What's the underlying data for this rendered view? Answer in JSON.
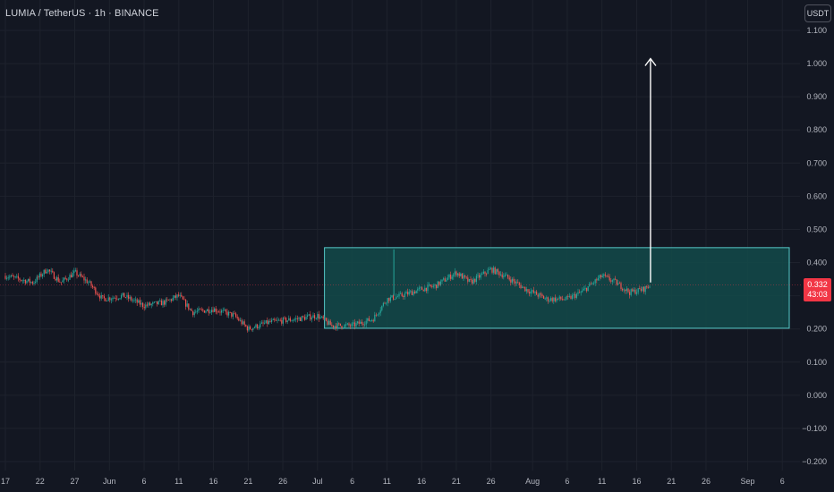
{
  "header": {
    "ticker_title": "LUMIA / TetherUS · 1h · BINANCE",
    "currency_label": "USDT"
  },
  "price_badge": {
    "value": "0.332",
    "countdown": "43:03"
  },
  "colors": {
    "background": "#131722",
    "grid": "#1e222d",
    "candle_up": "#26a69a",
    "candle_down": "#ef5350",
    "range_box_fill": "#134a4a",
    "range_box_border": "#56c8c8",
    "arrow": "#ffffff",
    "price_line": "#f23645"
  },
  "chart_data": {
    "type": "candlestick",
    "y_axis": {
      "min": -0.2,
      "max": 1.1,
      "ticks": [
        1.1,
        1.0,
        0.9,
        0.8,
        0.7,
        0.6,
        0.5,
        0.4,
        0.3,
        0.2,
        0.1,
        0.0,
        -0.1,
        -0.2
      ],
      "tick_labels": [
        "1.100",
        "1.000",
        "0.900",
        "0.800",
        "0.700",
        "0.600",
        "0.500",
        "0.400",
        "",
        "0.200",
        "0.100",
        "0.000",
        "−0.100",
        "−0.200"
      ]
    },
    "x_axis": {
      "start": "2025-05-17",
      "end": "2025-09-07",
      "ticks": [
        {
          "date": "2025-05-17",
          "label": "17"
        },
        {
          "date": "2025-05-22",
          "label": "22"
        },
        {
          "date": "2025-05-27",
          "label": "27"
        },
        {
          "date": "2025-06-01",
          "label": "Jun"
        },
        {
          "date": "2025-06-06",
          "label": "6"
        },
        {
          "date": "2025-06-11",
          "label": "11"
        },
        {
          "date": "2025-06-16",
          "label": "16"
        },
        {
          "date": "2025-06-21",
          "label": "21"
        },
        {
          "date": "2025-06-26",
          "label": "26"
        },
        {
          "date": "2025-07-01",
          "label": "Jul"
        },
        {
          "date": "2025-07-06",
          "label": "6"
        },
        {
          "date": "2025-07-11",
          "label": "11"
        },
        {
          "date": "2025-07-16",
          "label": "16"
        },
        {
          "date": "2025-07-21",
          "label": "21"
        },
        {
          "date": "2025-07-26",
          "label": "26"
        },
        {
          "date": "2025-08-01",
          "label": "Aug"
        },
        {
          "date": "2025-08-06",
          "label": "6"
        },
        {
          "date": "2025-08-11",
          "label": "11"
        },
        {
          "date": "2025-08-16",
          "label": "16"
        },
        {
          "date": "2025-08-21",
          "label": "21"
        },
        {
          "date": "2025-08-26",
          "label": "26"
        },
        {
          "date": "2025-09-01",
          "label": "Sep"
        },
        {
          "date": "2025-09-06",
          "label": "6"
        }
      ]
    },
    "last_price": 0.332,
    "price_path": [
      {
        "date": "2025-05-17",
        "price": 0.36
      },
      {
        "date": "2025-05-19",
        "price": 0.35
      },
      {
        "date": "2025-05-21",
        "price": 0.34
      },
      {
        "date": "2025-05-23",
        "price": 0.38
      },
      {
        "date": "2025-05-25",
        "price": 0.34
      },
      {
        "date": "2025-05-27",
        "price": 0.37
      },
      {
        "date": "2025-05-29",
        "price": 0.34
      },
      {
        "date": "2025-05-31",
        "price": 0.29
      },
      {
        "date": "2025-06-03",
        "price": 0.3
      },
      {
        "date": "2025-06-06",
        "price": 0.27
      },
      {
        "date": "2025-06-09",
        "price": 0.28
      },
      {
        "date": "2025-06-11",
        "price": 0.3
      },
      {
        "date": "2025-06-13",
        "price": 0.25
      },
      {
        "date": "2025-06-16",
        "price": 0.26
      },
      {
        "date": "2025-06-19",
        "price": 0.24
      },
      {
        "date": "2025-06-21",
        "price": 0.2
      },
      {
        "date": "2025-06-24",
        "price": 0.22
      },
      {
        "date": "2025-06-28",
        "price": 0.23
      },
      {
        "date": "2025-07-01",
        "price": 0.24
      },
      {
        "date": "2025-07-03",
        "price": 0.21
      },
      {
        "date": "2025-07-06",
        "price": 0.21
      },
      {
        "date": "2025-07-09",
        "price": 0.23
      },
      {
        "date": "2025-07-11",
        "price": 0.29
      },
      {
        "date": "2025-07-13",
        "price": 0.3
      },
      {
        "date": "2025-07-16",
        "price": 0.32
      },
      {
        "date": "2025-07-18",
        "price": 0.33
      },
      {
        "date": "2025-07-21",
        "price": 0.37
      },
      {
        "date": "2025-07-23",
        "price": 0.34
      },
      {
        "date": "2025-07-26",
        "price": 0.38
      },
      {
        "date": "2025-07-28",
        "price": 0.36
      },
      {
        "date": "2025-07-31",
        "price": 0.32
      },
      {
        "date": "2025-08-03",
        "price": 0.29
      },
      {
        "date": "2025-08-06",
        "price": 0.29
      },
      {
        "date": "2025-08-08",
        "price": 0.31
      },
      {
        "date": "2025-08-11",
        "price": 0.36
      },
      {
        "date": "2025-08-13",
        "price": 0.34
      },
      {
        "date": "2025-08-15",
        "price": 0.31
      },
      {
        "date": "2025-08-17",
        "price": 0.32
      },
      {
        "date": "2025-08-18",
        "price": 0.332
      }
    ],
    "annotations": {
      "range_box": {
        "date_start": "2025-07-02",
        "date_end": "2025-09-07",
        "price_top": 0.445,
        "price_bottom": 0.202
      },
      "target_arrow": {
        "date": "2025-08-18",
        "price_from": 0.34,
        "price_to": 1.015
      },
      "price_line": 0.332
    }
  }
}
